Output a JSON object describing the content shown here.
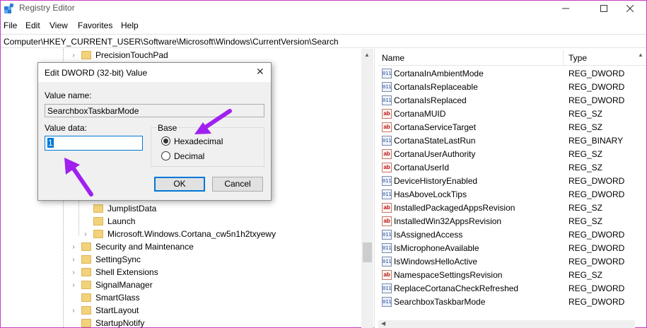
{
  "window": {
    "title": "Registry Editor"
  },
  "menu": [
    "File",
    "Edit",
    "View",
    "Favorites",
    "Help"
  ],
  "address": "Computer\\HKEY_CURRENT_USER\\Software\\Microsoft\\Windows\\CurrentVersion\\Search",
  "tree": {
    "top_item": "PrecisionTouchPad",
    "sub_items": [
      "JumplistData",
      "Launch",
      "Microsoft.Windows.Cortana_cw5n1h2txyewy"
    ],
    "items": [
      "Security and Maintenance",
      "SettingSync",
      "Shell Extensions",
      "SignalManager",
      "SmartGlass",
      "StartLayout",
      "StartupNotify"
    ]
  },
  "list": {
    "col_name": "Name",
    "col_type": "Type",
    "rows": [
      {
        "icon": "dword-icon",
        "name": "CortanaInAmbientMode",
        "type": "REG_DWORD"
      },
      {
        "icon": "dword-icon",
        "name": "CortanaIsReplaceable",
        "type": "REG_DWORD"
      },
      {
        "icon": "dword-icon",
        "name": "CortanaIsReplaced",
        "type": "REG_DWORD"
      },
      {
        "icon": "string-icon",
        "name": "CortanaMUID",
        "type": "REG_SZ"
      },
      {
        "icon": "string-icon",
        "name": "CortanaServiceTarget",
        "type": "REG_SZ"
      },
      {
        "icon": "dword-icon",
        "name": "CortanaStateLastRun",
        "type": "REG_BINARY"
      },
      {
        "icon": "string-icon",
        "name": "CortanaUserAuthority",
        "type": "REG_SZ"
      },
      {
        "icon": "string-icon",
        "name": "CortanaUserId",
        "type": "REG_SZ"
      },
      {
        "icon": "dword-icon",
        "name": "DeviceHistoryEnabled",
        "type": "REG_DWORD"
      },
      {
        "icon": "dword-icon",
        "name": "HasAboveLockTips",
        "type": "REG_DWORD"
      },
      {
        "icon": "string-icon",
        "name": "InstalledPackagedAppsRevision",
        "type": "REG_SZ"
      },
      {
        "icon": "string-icon",
        "name": "InstalledWin32AppsRevision",
        "type": "REG_SZ"
      },
      {
        "icon": "dword-icon",
        "name": "IsAssignedAccess",
        "type": "REG_DWORD"
      },
      {
        "icon": "dword-icon",
        "name": "IsMicrophoneAvailable",
        "type": "REG_DWORD"
      },
      {
        "icon": "dword-icon",
        "name": "IsWindowsHelloActive",
        "type": "REG_DWORD"
      },
      {
        "icon": "string-icon",
        "name": "NamespaceSettingsRevision",
        "type": "REG_SZ"
      },
      {
        "icon": "dword-icon",
        "name": "ReplaceCortanaCheckRefreshed",
        "type": "REG_DWORD"
      },
      {
        "icon": "dword-icon",
        "name": "SearchboxTaskbarMode",
        "type": "REG_DWORD"
      }
    ]
  },
  "dialog": {
    "title": "Edit DWORD (32-bit) Value",
    "value_name_label": "Value name:",
    "value_name": "SearchboxTaskbarMode",
    "value_data_label": "Value data:",
    "value_data": "1",
    "base_label": "Base",
    "radio_hex": "Hexadecimal",
    "radio_dec": "Decimal",
    "selected_base": "Hexadecimal",
    "ok_label": "OK",
    "cancel_label": "Cancel"
  },
  "colors": {
    "annotation_arrow": "#a020f0",
    "window_border": "#c83cc4",
    "selection": "#0078d7"
  }
}
